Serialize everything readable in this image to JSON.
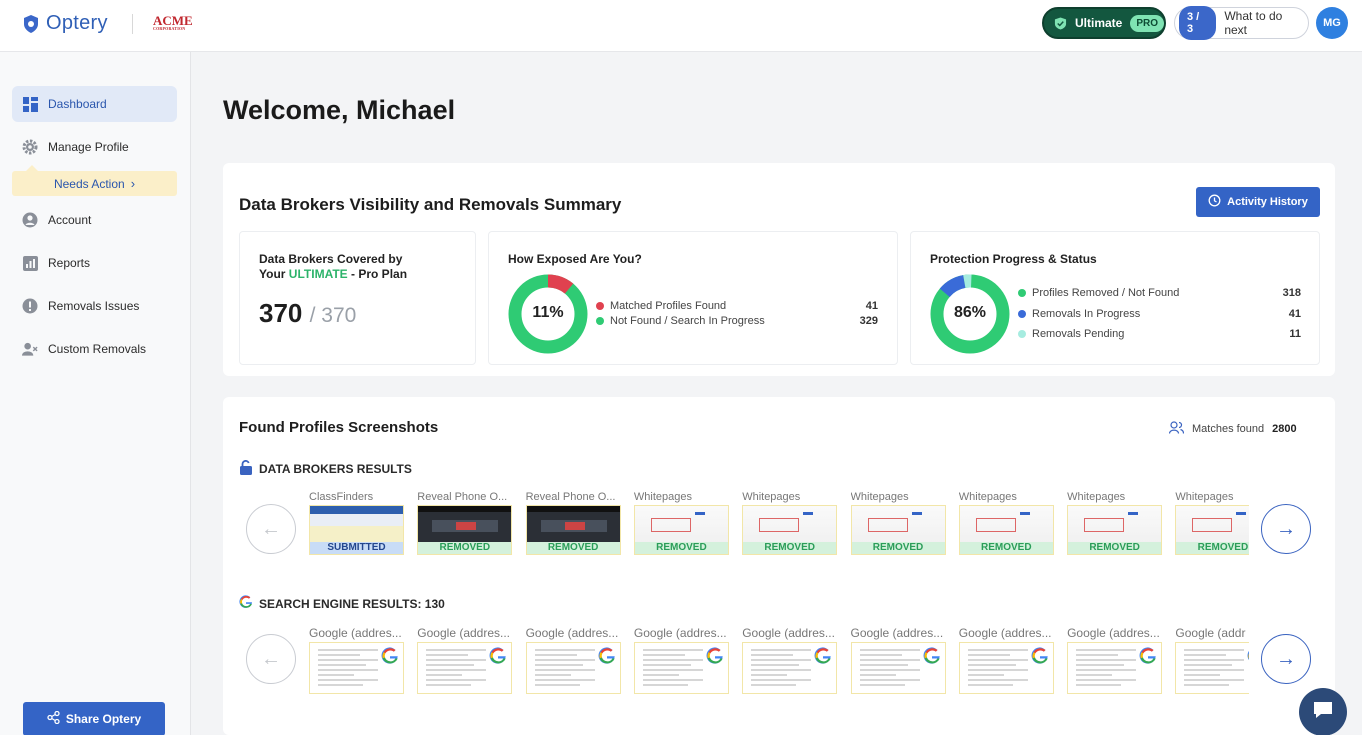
{
  "brand": {
    "name": "Optery",
    "partner": "ACME",
    "partner_sub": "CORPORATION"
  },
  "header": {
    "plan_label": "Ultimate",
    "plan_badge": "PRO",
    "steps": "3 / 3",
    "next_label": "What to do next",
    "avatar_initials": "MG"
  },
  "sidebar": {
    "items": [
      {
        "label": "Dashboard",
        "icon": "grid-icon"
      },
      {
        "label": "Manage Profile",
        "icon": "gear-icon"
      },
      {
        "label": "Account",
        "icon": "user-circle-icon"
      },
      {
        "label": "Reports",
        "icon": "bar-chart-icon"
      },
      {
        "label": "Removals Issues",
        "icon": "alert-icon"
      },
      {
        "label": "Custom Removals",
        "icon": "user-remove-icon"
      }
    ],
    "needs_action": "Needs Action",
    "share_label": "Share Optery"
  },
  "welcome": "Welcome, Michael",
  "summary": {
    "title": "Data Brokers Visibility and Removals Summary",
    "activity_label": "Activity History",
    "coverage": {
      "title_pre": "Data Brokers Covered by",
      "title_your": "Your",
      "title_plan": "ULTIMATE",
      "title_post": "- Pro Plan",
      "covered": "370",
      "total": "/ 370"
    },
    "exposure": {
      "title": "How Exposed Are You?",
      "percent_label": "11%",
      "rows": [
        {
          "label": "Matched Profiles Found",
          "value": "41",
          "color": "#e0414f"
        },
        {
          "label": "Not Found / Search In Progress",
          "value": "329",
          "color": "#2fcb74"
        }
      ]
    },
    "protection": {
      "title": "Protection Progress & Status",
      "percent_label": "86%",
      "rows": [
        {
          "label": "Profiles Removed / Not Found",
          "value": "318",
          "color": "#2fcb74"
        },
        {
          "label": "Removals In Progress",
          "value": "41",
          "color": "#3a6bd8"
        },
        {
          "label": "Removals Pending",
          "value": "11",
          "color": "#a6ece0"
        }
      ]
    }
  },
  "found": {
    "title": "Found Profiles Screenshots",
    "matches_label": "Matches found",
    "matches_value": "2800",
    "brokers_heading": "DATA BROKERS RESULTS",
    "brokers": [
      {
        "name": "ClassFinders",
        "status": "SUBMITTED"
      },
      {
        "name": "Reveal Phone O...",
        "status": "REMOVED"
      },
      {
        "name": "Reveal Phone O...",
        "status": "REMOVED"
      },
      {
        "name": "Whitepages",
        "status": "REMOVED"
      },
      {
        "name": "Whitepages",
        "status": "REMOVED"
      },
      {
        "name": "Whitepages",
        "status": "REMOVED"
      },
      {
        "name": "Whitepages",
        "status": "REMOVED"
      },
      {
        "name": "Whitepages",
        "status": "REMOVED"
      },
      {
        "name": "Whitepages",
        "status": "REMOVED"
      }
    ],
    "search_heading": "SEARCH ENGINE RESULTS: 130",
    "search": [
      {
        "name": "Google (addres..."
      },
      {
        "name": "Google (addres..."
      },
      {
        "name": "Google (addres..."
      },
      {
        "name": "Google (addres..."
      },
      {
        "name": "Google (addres..."
      },
      {
        "name": "Google (addres..."
      },
      {
        "name": "Google (addres..."
      },
      {
        "name": "Google (addres..."
      },
      {
        "name": "Google (addr"
      }
    ],
    "prev_arrow": "←",
    "next_arrow": "→"
  }
}
